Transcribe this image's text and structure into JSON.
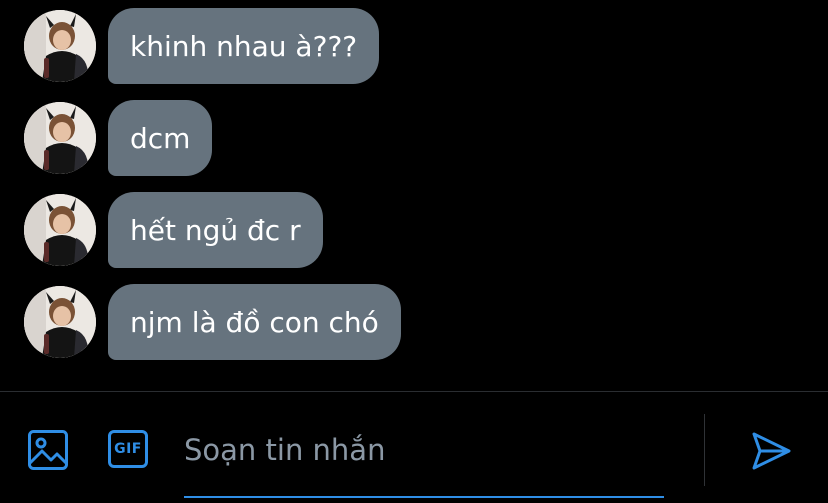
{
  "thread": {
    "messages": [
      {
        "text": "khinh nhau à???"
      },
      {
        "text": "dcm"
      },
      {
        "text": "hết ngủ đc r"
      },
      {
        "text": "njm là đồ con chó"
      }
    ]
  },
  "composer": {
    "placeholder": "Soạn tin nhắn",
    "gif_label": "GIF",
    "icons": [
      "image-icon",
      "gif-icon",
      "send-icon"
    ]
  },
  "colors": {
    "background": "#000000",
    "bubble": "#66737e",
    "accent": "#2f8ee6",
    "placeholder": "#8b98a5"
  }
}
